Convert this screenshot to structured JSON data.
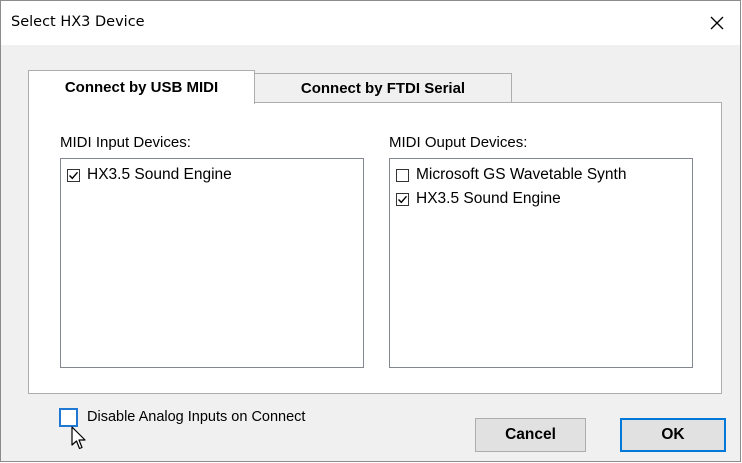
{
  "window": {
    "title": "Select HX3 Device",
    "close_icon": "close-icon"
  },
  "tabs": [
    {
      "label": "Connect by USB MIDI",
      "active": true
    },
    {
      "label": "Connect by FTDI Serial",
      "active": false
    }
  ],
  "midi_input": {
    "label": "MIDI Input Devices:",
    "items": [
      {
        "label": "HX3.5 Sound Engine",
        "checked": true
      }
    ]
  },
  "midi_output": {
    "label": "MIDI Ouput Devices:",
    "items": [
      {
        "label": "Microsoft GS Wavetable Synth",
        "checked": false
      },
      {
        "label": "HX3.5 Sound Engine",
        "checked": true
      }
    ]
  },
  "options": {
    "disable_analog_label": "Disable Analog Inputs on Connect",
    "disable_analog_checked": false
  },
  "buttons": {
    "cancel": "Cancel",
    "ok": "OK"
  },
  "colors": {
    "focus_blue": "#0078d7",
    "dialog_bg": "#f0f0f0"
  }
}
